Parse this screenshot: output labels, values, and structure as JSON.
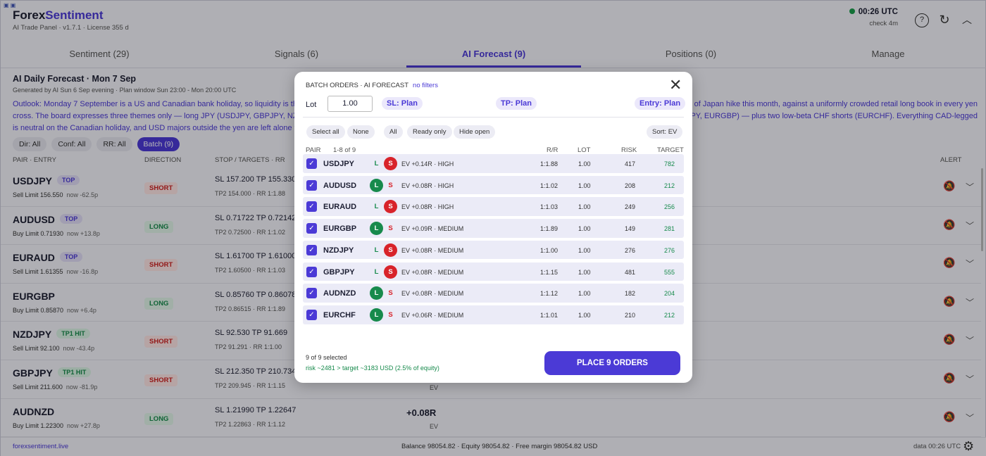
{
  "header": {
    "logo_main": "Forex",
    "logo_accent": "Sentiment",
    "subtitle": "AI Trade Panel · v1.7.1 · License 355 d",
    "clock": "00:26 UTC",
    "check": "check 4m"
  },
  "tabs": [
    {
      "label": "Sentiment (29)"
    },
    {
      "label": "Signals (6)"
    },
    {
      "label": "AI Forecast (9)"
    },
    {
      "label": "Positions (0)"
    },
    {
      "label": "Manage"
    }
  ],
  "forecast": {
    "title": "AI Daily Forecast · Mon 7 Sep",
    "generated": "Generated by AI Sun 6 Sep evening · Plan window Sun 23:00 - Mon 20:00 UTC",
    "outlook_left": "Outlook: Monday 7 September is a US and Canadian bank holiday, so liquidity is thin ar",
    "outlook_right": "ank of Japan hike this month, against a uniformly crowded retail long book in every yen",
    "outlook_line2_left": "cross. The board expresses three themes only — long JPY (USDJPY, GBPJPY, NZDJPY), l",
    "outlook_line2_right": "GBPJPY, EURGBP) — plus two low-beta CHF shorts (EURCHF). Everything CAD-legged",
    "outlook_line3": "is neutral on the Canadian holiday, and USD majors outside the yen are left alone with"
  },
  "filters": [
    {
      "label": "Dir: All"
    },
    {
      "label": "Conf: All"
    },
    {
      "label": "RR: All"
    },
    {
      "label": "Batch (9)"
    }
  ],
  "columns": {
    "pair_entry": "PAIR · ENTRY",
    "direction": "DIRECTION",
    "stop_targets": "STOP / TARGETS · RR",
    "alert": "ALERT"
  },
  "rows": [
    {
      "pair": "USDJPY",
      "tag": "TOP",
      "entry": "Sell Limit 156.550",
      "now": "now -62.5p",
      "dir": "SHORT",
      "stop": "SL 157.200  TP 155.330",
      "tp2": "TP2 154.000 · RR 1:1.88",
      "ev": "",
      "ev_lbl": ""
    },
    {
      "pair": "AUDUSD",
      "tag": "TOP",
      "entry": "Buy Limit 0.71930",
      "now": "now +13.8p",
      "dir": "LONG",
      "stop": "SL 0.71722  TP 0.72142",
      "tp2": "TP2 0.72500 · RR 1:1.02",
      "ev": "",
      "ev_lbl": ""
    },
    {
      "pair": "EURAUD",
      "tag": "TOP",
      "entry": "Sell Limit 1.61355",
      "now": "now -16.8p",
      "dir": "SHORT",
      "stop": "SL 1.61700  TP 1.61000",
      "tp2": "TP2 1.60500 · RR 1:1.03",
      "ev": "",
      "ev_lbl": ""
    },
    {
      "pair": "EURGBP",
      "tag": "",
      "entry": "Buy Limit 0.85870",
      "now": "now +6.4p",
      "dir": "LONG",
      "stop": "SL 0.85760  TP 0.86078",
      "tp2": "TP2 0.86515 · RR 1:1.89",
      "ev": "",
      "ev_lbl": ""
    },
    {
      "pair": "NZDJPY",
      "tag": "TP1 HIT",
      "entry": "Sell Limit 92.100",
      "now": "now -43.4p",
      "dir": "SHORT",
      "stop": "SL 92.530  TP 91.669",
      "tp2": "TP2 91.291 · RR 1:1.00",
      "ev": "",
      "ev_lbl": ""
    },
    {
      "pair": "GBPJPY",
      "tag": "TP1 HIT",
      "entry": "Sell Limit 211.600",
      "now": "now -81.9p",
      "dir": "SHORT",
      "stop": "SL 212.350  TP 210.734",
      "tp2": "TP2 209.945 · RR 1:1.15",
      "ev": "",
      "ev_lbl": "EV"
    },
    {
      "pair": "AUDNZD",
      "tag": "",
      "entry": "Buy Limit 1.22300",
      "now": "now +27.8p",
      "dir": "LONG",
      "stop": "SL 1.21990  TP 1.22647",
      "tp2": "TP2 1.22863 · RR 1:1.12",
      "ev": "+0.08R",
      "ev_lbl": "EV"
    }
  ],
  "footer": {
    "link": "forexsentiment.live",
    "balance": "Balance 98054.82 · Equity 98054.82 · Free margin 98054.82 USD",
    "data": "data 00:26 UTC"
  },
  "modal": {
    "title": "BATCH ORDERS · AI FORECAST",
    "no_filters": "no filters",
    "lot_label": "Lot",
    "lot_value": "1.00",
    "sl_plan": "SL: Plan",
    "tp_plan": "TP: Plan",
    "entry_plan": "Entry: Plan",
    "buttons": {
      "select_all": "Select all",
      "none": "None",
      "all": "All",
      "ready_only": "Ready only",
      "hide_open": "Hide open",
      "sort": "Sort: EV"
    },
    "col": {
      "pair": "PAIR",
      "range": "1-8 of 9",
      "rr": "R/R",
      "lot": "LOT",
      "risk": "RISK",
      "target": "TARGET"
    },
    "items": [
      {
        "pair": "USDJPY",
        "side": "S",
        "ev": "EV +0.14R · HIGH",
        "rr": "1:1.88",
        "lot": "1.00",
        "risk": "417",
        "target": "782"
      },
      {
        "pair": "AUDUSD",
        "side": "L",
        "ev": "EV +0.08R · HIGH",
        "rr": "1:1.02",
        "lot": "1.00",
        "risk": "208",
        "target": "212"
      },
      {
        "pair": "EURAUD",
        "side": "S",
        "ev": "EV +0.08R · HIGH",
        "rr": "1:1.03",
        "lot": "1.00",
        "risk": "249",
        "target": "256"
      },
      {
        "pair": "EURGBP",
        "side": "L",
        "ev": "EV +0.09R · MEDIUM",
        "rr": "1:1.89",
        "lot": "1.00",
        "risk": "149",
        "target": "281"
      },
      {
        "pair": "NZDJPY",
        "side": "S",
        "ev": "EV +0.08R · MEDIUM",
        "rr": "1:1.00",
        "lot": "1.00",
        "risk": "276",
        "target": "276"
      },
      {
        "pair": "GBPJPY",
        "side": "S",
        "ev": "EV +0.08R · MEDIUM",
        "rr": "1:1.15",
        "lot": "1.00",
        "risk": "481",
        "target": "555"
      },
      {
        "pair": "AUDNZD",
        "side": "L",
        "ev": "EV +0.08R · MEDIUM",
        "rr": "1:1.12",
        "lot": "1.00",
        "risk": "182",
        "target": "204"
      },
      {
        "pair": "EURCHF",
        "side": "L",
        "ev": "EV +0.06R · MEDIUM",
        "rr": "1:1.01",
        "lot": "1.00",
        "risk": "210",
        "target": "212"
      }
    ],
    "selected": "9 of 9 selected",
    "risk_summary": "risk ~2481 > target ~3183 USD (2.5% of equity)",
    "place": "PLACE 9 ORDERS"
  }
}
